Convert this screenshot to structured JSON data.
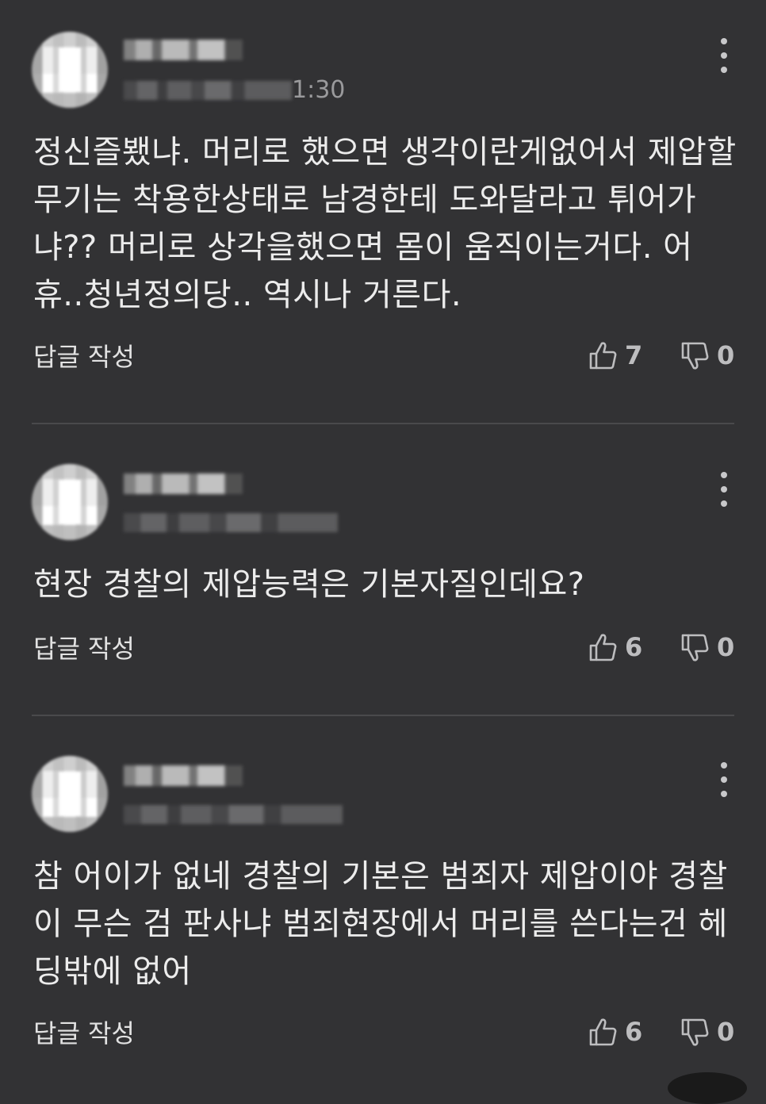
{
  "comments": [
    {
      "time_fragment": "1:30",
      "body": "정신즐뵀냐. 머리로 했으면 생각이란게없어서 제압할 무기는 착용한상태로 남경한테 도와달라고 튀어가냐?? 머리로 상각을했으면 몸이 움직이는거다. 어휴..청년정의당.. 역시나 거른다.",
      "reply_label": "답글 작성",
      "likes": "7",
      "dislikes": "0"
    },
    {
      "time_fragment": "",
      "body": "현장 경찰의 제압능력은 기본자질인데요?",
      "reply_label": "답글 작성",
      "likes": "6",
      "dislikes": "0"
    },
    {
      "time_fragment": "",
      "body": "참 어이가 없네 경찰의 기본은 범죄자 제압이야 경찰이 무슨 검 판사냐 범죄현장에서 머리를 쓴다는건 헤딩밖에 없어",
      "reply_label": "답글 작성",
      "likes": "6",
      "dislikes": "0"
    }
  ],
  "icons": {
    "more": "more-vertical-icon",
    "like": "thumbs-up-icon",
    "dislike": "thumbs-down-icon"
  },
  "colors": {
    "background": "#323234",
    "text": "#ececec",
    "muted": "#bdbdbf",
    "divider": "#4a4a4c"
  }
}
